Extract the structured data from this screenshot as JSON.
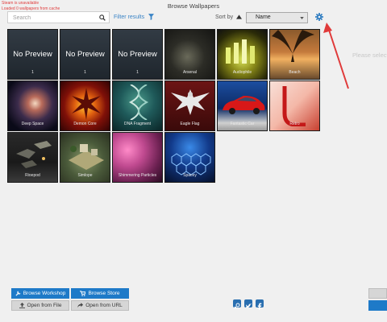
{
  "status": {
    "line1": "Steam is unavailable",
    "line2": "Loaded 0 wallpapers from cache"
  },
  "title": "Browse Wallpapers",
  "search": {
    "placeholder": "Search"
  },
  "filter_label": "Filter results",
  "sort": {
    "label": "Sort by",
    "selected": "Name"
  },
  "hint": "Please select",
  "no_preview_label": "No Preview",
  "wallpapers": [
    {
      "name": "1",
      "preview": false
    },
    {
      "name": "1",
      "preview": false
    },
    {
      "name": "1",
      "preview": false
    },
    {
      "name": "Arsenal",
      "preview": true
    },
    {
      "name": "Audiophile",
      "preview": true
    },
    {
      "name": "Beach",
      "preview": true
    },
    {
      "name": "Deep Space",
      "preview": true
    },
    {
      "name": "Demon Core",
      "preview": true
    },
    {
      "name": "DNA Fragment",
      "preview": true
    },
    {
      "name": "Eagle Flag",
      "preview": true
    },
    {
      "name": "Fantastic Car",
      "preview": true
    },
    {
      "name": "Retro",
      "preview": true
    },
    {
      "name": "Rioepod",
      "preview": true
    },
    {
      "name": "Simlope",
      "preview": true
    },
    {
      "name": "Shimmering Particles",
      "preview": true
    },
    {
      "name": "Spacey",
      "preview": true
    }
  ],
  "buttons": {
    "browse_workshop": "Browse Workshop",
    "browse_store": "Browse Store",
    "open_file": "Open from File",
    "open_url": "Open from URL"
  },
  "colors": {
    "accent": "#1e7ac8",
    "status_red": "#e04040",
    "arrow_red": "#e03a3a"
  }
}
